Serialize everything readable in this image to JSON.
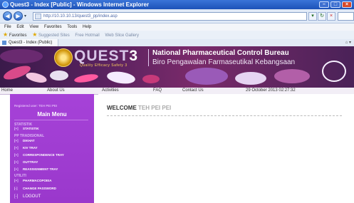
{
  "window": {
    "title": "Quest3 - Index [Public] - Windows Internet Explorer"
  },
  "browser": {
    "address": "http://10.10.10.13/quest3_pp/index.asp",
    "menu": [
      "File",
      "Edit",
      "View",
      "Favorites",
      "Tools",
      "Help"
    ],
    "favorites_label": "Favorites",
    "favorites_items": [
      "Suggested Sites",
      "Free Hotmail",
      "Web Slice Gallery"
    ],
    "tab_title": "Quest3 - Index (Public)"
  },
  "banner": {
    "logo_text": "QUEST",
    "logo_number": "3",
    "tagline": "Quality Efficacy Safety 3",
    "title_en": "National Pharmaceutical Control Bureau",
    "title_ms": "Biro Pengawalan Farmaseutikal Kebangsaan"
  },
  "nav": {
    "items": [
      "Home",
      "About Us",
      "Activities",
      "FAQ",
      "Contact Us"
    ],
    "datetime": "29 October 2013 02:27:32"
  },
  "sidebar": {
    "registered": "Registered user: TEH PEI PEI",
    "title": "Main Menu",
    "sections": [
      {
        "heading": "STATISTIK",
        "items": [
          "STATISTIK"
        ]
      },
      {
        "heading": "PP TRADISIONAL",
        "items": [
          "DIKHAT",
          "KIV TRAY",
          "CORRESPONDENCE TRAY",
          "OUTTRAY",
          "REASSIGNMENT TRAY"
        ]
      },
      {
        "heading": "UTILITI",
        "items": [
          "PHARMACOPOEIA",
          "CHANGE PASSWORD",
          "LOGOUT"
        ]
      }
    ]
  },
  "content": {
    "welcome_label": "WELCOME",
    "user_name": "TEH PEI PEI"
  },
  "colors": {
    "sidebar": "#a642d8",
    "banner": "#5a2260",
    "titlebar": "#1c52b8"
  }
}
